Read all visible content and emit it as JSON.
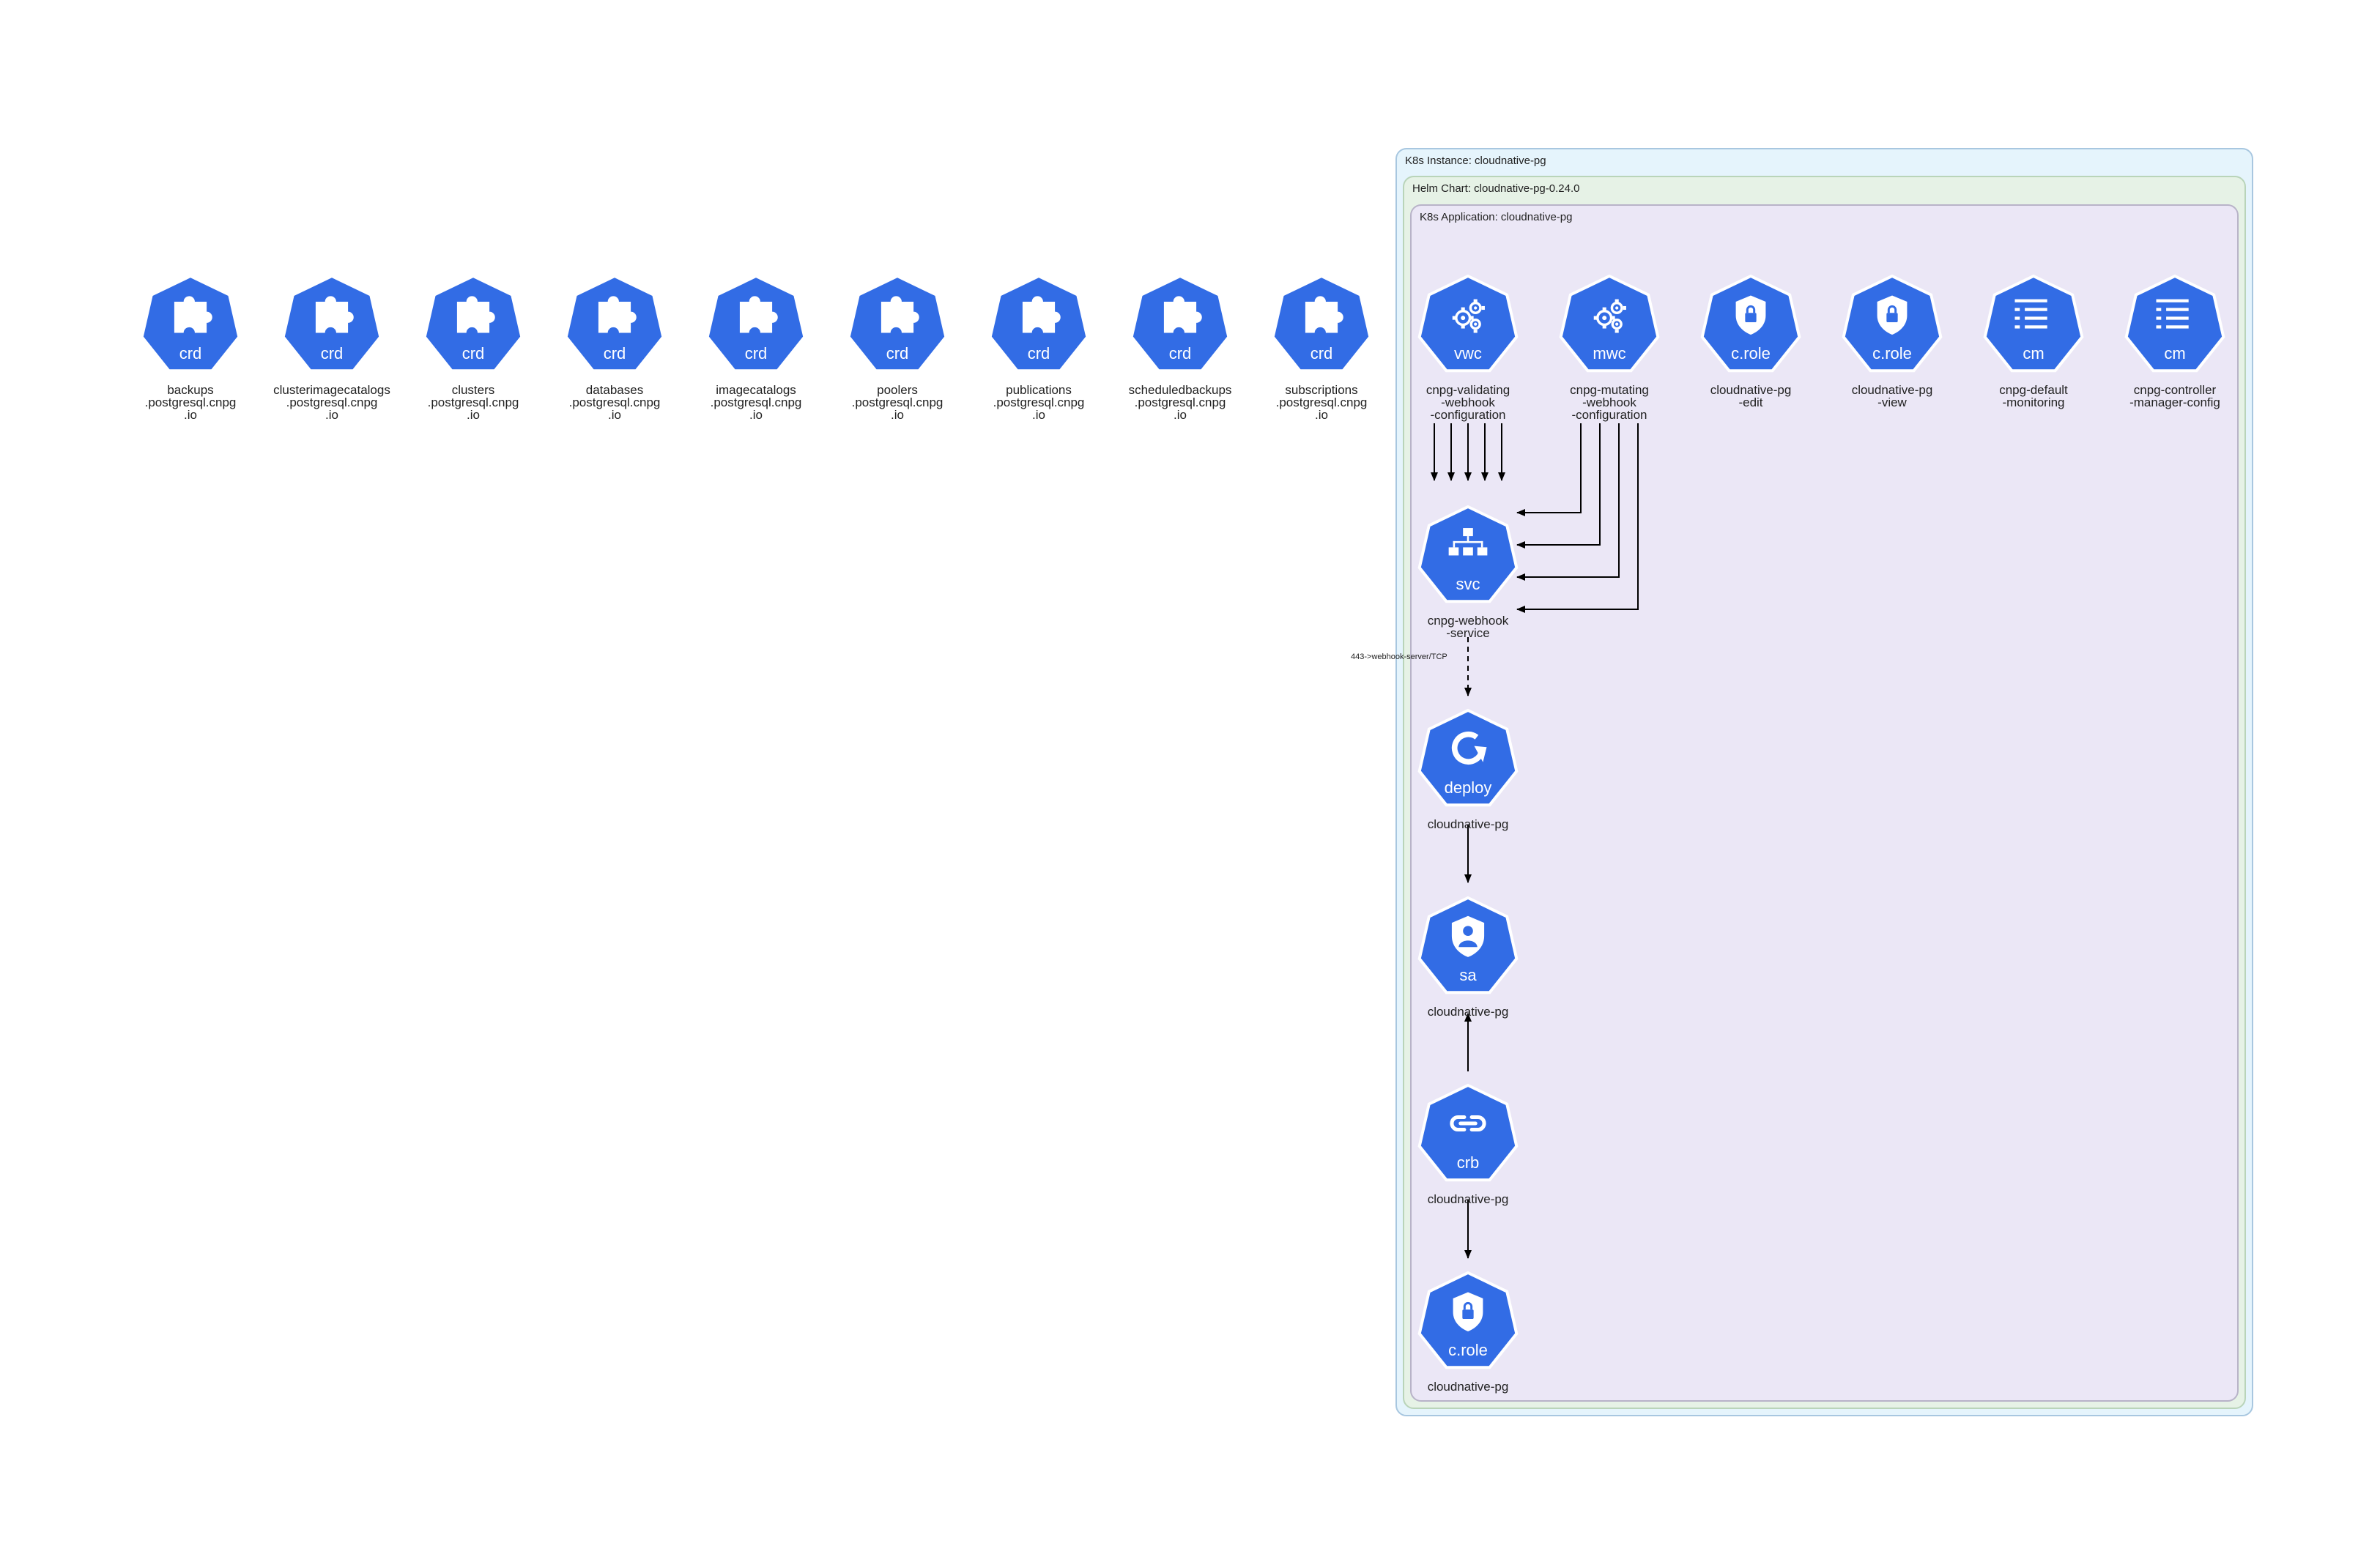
{
  "clusters": {
    "instance": "K8s Instance: cloudnative-pg",
    "chart": "Helm Chart: cloudnative-pg-0.24.0",
    "application": "K8s Application: cloudnative-pg"
  },
  "colors": {
    "node_fill": "#326ce5",
    "node_stroke": "#ffffff",
    "instance_fill": "#e5f4fc",
    "instance_stroke": "#a8c7e0",
    "chart_fill": "#e6f2e6",
    "chart_stroke": "#b9d4b9",
    "application_fill": "#ebe7f6",
    "application_stroke": "#b8b3c8"
  },
  "crds": [
    {
      "abbr": "crd",
      "icon": "puzzle-icon",
      "caption": [
        "backups",
        ".postgresql.cnpg",
        ".io"
      ]
    },
    {
      "abbr": "crd",
      "icon": "puzzle-icon",
      "caption": [
        "clusterimagecatalogs",
        ".postgresql.cnpg",
        ".io"
      ]
    },
    {
      "abbr": "crd",
      "icon": "puzzle-icon",
      "caption": [
        "clusters",
        ".postgresql.cnpg",
        ".io"
      ]
    },
    {
      "abbr": "crd",
      "icon": "puzzle-icon",
      "caption": [
        "databases",
        ".postgresql.cnpg",
        ".io"
      ]
    },
    {
      "abbr": "crd",
      "icon": "puzzle-icon",
      "caption": [
        "imagecatalogs",
        ".postgresql.cnpg",
        ".io"
      ]
    },
    {
      "abbr": "crd",
      "icon": "puzzle-icon",
      "caption": [
        "poolers",
        ".postgresql.cnpg",
        ".io"
      ]
    },
    {
      "abbr": "crd",
      "icon": "puzzle-icon",
      "caption": [
        "publications",
        ".postgresql.cnpg",
        ".io"
      ]
    },
    {
      "abbr": "crd",
      "icon": "puzzle-icon",
      "caption": [
        "scheduledbackups",
        ".postgresql.cnpg",
        ".io"
      ]
    },
    {
      "abbr": "crd",
      "icon": "puzzle-icon",
      "caption": [
        "subscriptions",
        ".postgresql.cnpg",
        ".io"
      ]
    }
  ],
  "app_nodes": {
    "vwc": {
      "abbr": "vwc",
      "icon": "gears-icon",
      "caption": [
        "cnpg-validating",
        "-webhook",
        "-configuration"
      ]
    },
    "mwc": {
      "abbr": "mwc",
      "icon": "gears-icon",
      "caption": [
        "cnpg-mutating",
        "-webhook",
        "-configuration"
      ]
    },
    "crole_edit": {
      "abbr": "c.role",
      "icon": "lock-shield-icon",
      "caption": [
        "cloudnative-pg",
        "-edit"
      ]
    },
    "crole_view": {
      "abbr": "c.role",
      "icon": "lock-shield-icon",
      "caption": [
        "cloudnative-pg",
        "-view"
      ]
    },
    "cm_monitoring": {
      "abbr": "cm",
      "icon": "config-list-icon",
      "caption": [
        "cnpg-default",
        "-monitoring"
      ]
    },
    "cm_manager": {
      "abbr": "cm",
      "icon": "config-list-icon",
      "caption": [
        "cnpg-controller",
        "-manager-config"
      ]
    },
    "svc": {
      "abbr": "svc",
      "icon": "network-tree-icon",
      "caption": [
        "cnpg-webhook",
        "-service"
      ]
    },
    "deploy": {
      "abbr": "deploy",
      "icon": "rollout-arrow-icon",
      "caption": [
        "cloudnative-pg"
      ]
    },
    "sa": {
      "abbr": "sa",
      "icon": "user-shield-icon",
      "caption": [
        "cloudnative-pg"
      ]
    },
    "crb": {
      "abbr": "crb",
      "icon": "link-icon",
      "caption": [
        "cloudnative-pg"
      ]
    },
    "crole": {
      "abbr": "c.role",
      "icon": "lock-shield-icon",
      "caption": [
        "cloudnative-pg"
      ]
    }
  },
  "edges": {
    "svc_to_deploy_label": "443->webhook-server/TCP"
  }
}
